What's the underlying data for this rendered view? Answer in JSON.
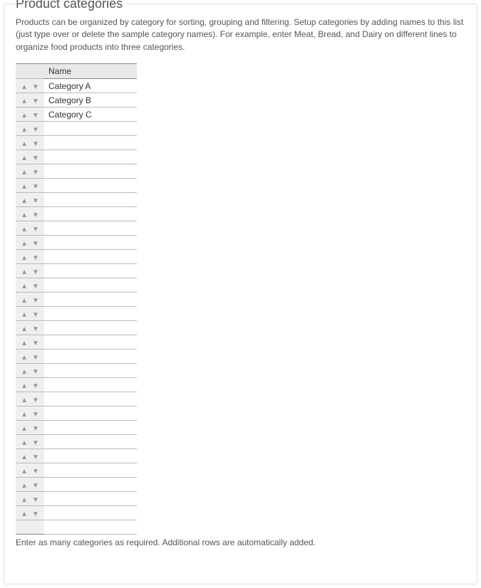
{
  "panel": {
    "title": "Product categories",
    "description": "Products can be organized by category for sorting, grouping and filtering. Setup categories by adding names to this list (just type over or delete the sample category names). For example, enter Meat, Bread, and Dairy on different lines to organize food products into three categories.",
    "footer": "Enter as many categories as required. Additional rows are automatically added."
  },
  "table": {
    "header_name": "Name",
    "rows": [
      {
        "name": "Category A"
      },
      {
        "name": "Category B"
      },
      {
        "name": "Category C"
      },
      {
        "name": ""
      },
      {
        "name": ""
      },
      {
        "name": ""
      },
      {
        "name": ""
      },
      {
        "name": ""
      },
      {
        "name": ""
      },
      {
        "name": ""
      },
      {
        "name": ""
      },
      {
        "name": ""
      },
      {
        "name": ""
      },
      {
        "name": ""
      },
      {
        "name": ""
      },
      {
        "name": ""
      },
      {
        "name": ""
      },
      {
        "name": ""
      },
      {
        "name": ""
      },
      {
        "name": ""
      },
      {
        "name": ""
      },
      {
        "name": ""
      },
      {
        "name": ""
      },
      {
        "name": ""
      },
      {
        "name": ""
      },
      {
        "name": ""
      },
      {
        "name": ""
      },
      {
        "name": ""
      },
      {
        "name": ""
      },
      {
        "name": ""
      },
      {
        "name": ""
      }
    ]
  }
}
